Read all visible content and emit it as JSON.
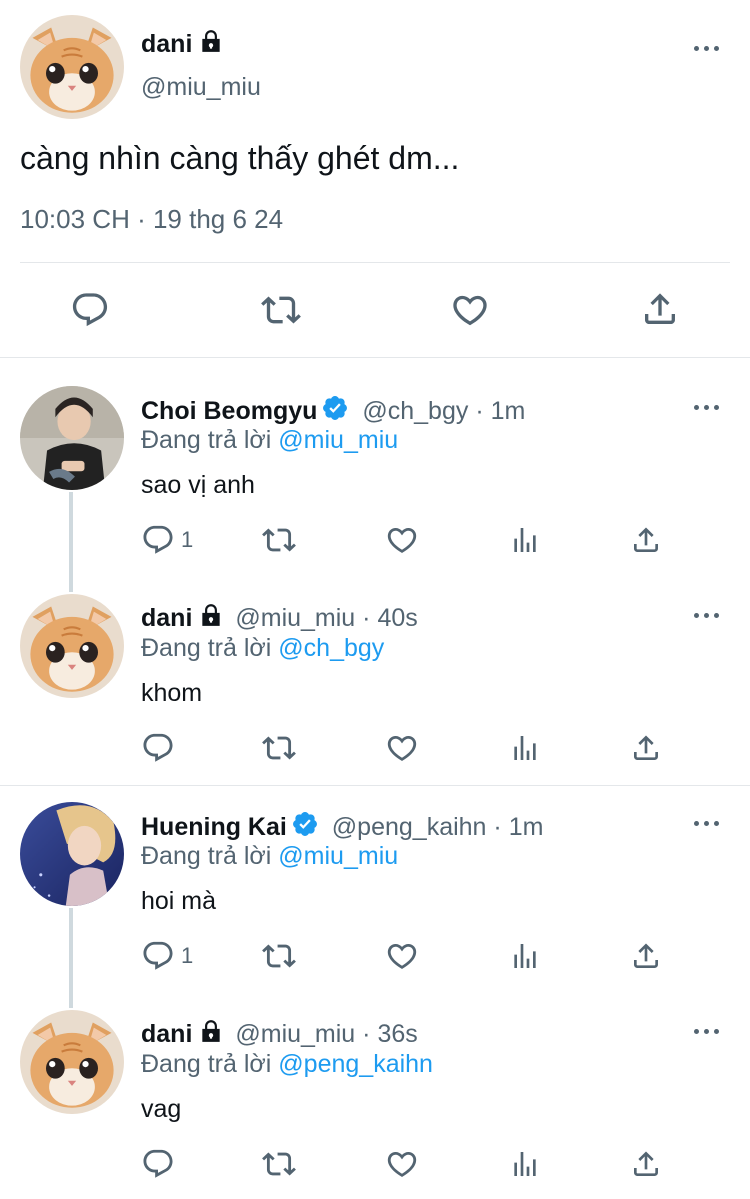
{
  "main_tweet": {
    "name": "dani",
    "handle": "@miu_miu",
    "text": "càng nhìn càng thấy ghét dm...",
    "timestamp": "10:03 CH · 19 thg 6 24"
  },
  "replies": [
    {
      "name": "Choi Beomgyu",
      "verified": true,
      "handle": "@ch_bgy",
      "time": "1m",
      "replying_label": "Đang trả lời",
      "replying_to": "@miu_miu",
      "text": "sao vị anh",
      "reply_count": "1"
    },
    {
      "name": "dani",
      "locked": true,
      "handle": "@miu_miu",
      "time": "40s",
      "replying_label": "Đang trả lời",
      "replying_to": "@ch_bgy",
      "text": "khom",
      "reply_count": ""
    },
    {
      "name": "Huening Kai",
      "verified": true,
      "handle": "@peng_kaihn",
      "time": "1m",
      "replying_label": "Đang trả lời",
      "replying_to": "@miu_miu",
      "text": "hoi mà",
      "reply_count": "1"
    },
    {
      "name": "dani",
      "locked": true,
      "handle": "@miu_miu",
      "time": "36s",
      "replying_label": "Đang trả lời",
      "replying_to": "@peng_kaihn",
      "text": "vag",
      "reply_count": ""
    }
  ],
  "colors": {
    "accent": "#1d9bf0",
    "muted": "#536471",
    "text": "#0f1419"
  },
  "separator": "·"
}
